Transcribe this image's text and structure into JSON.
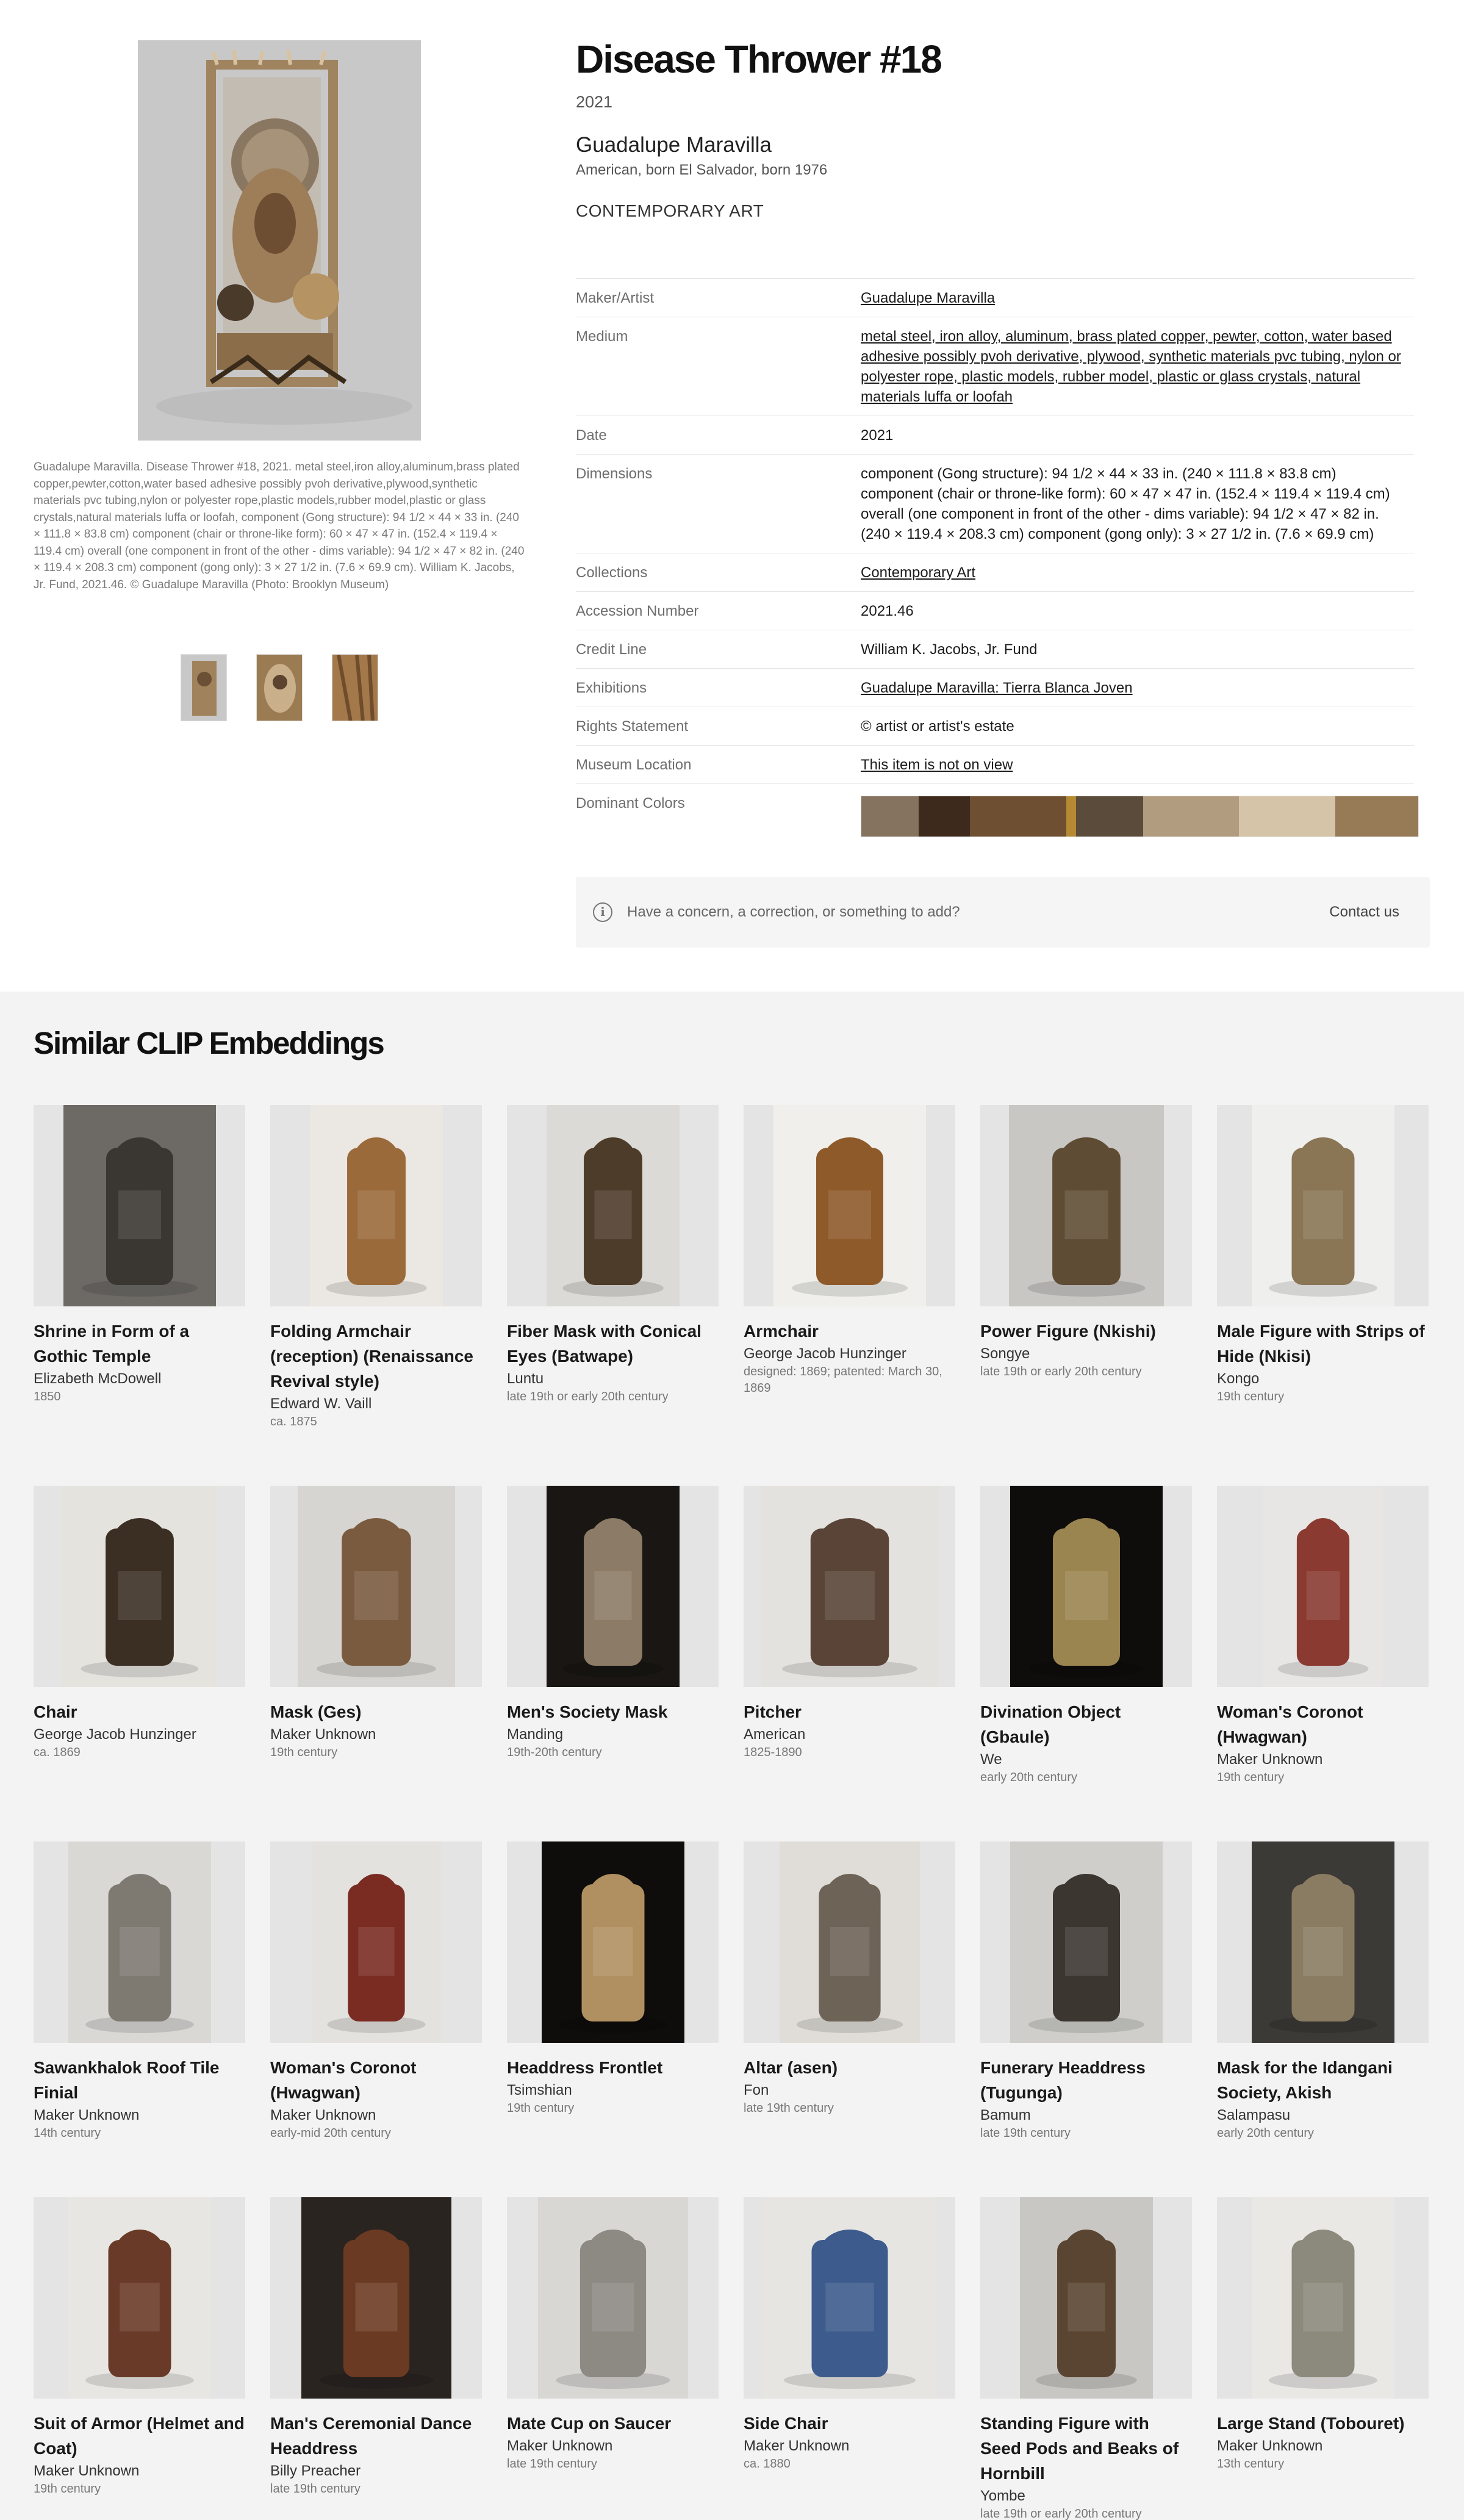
{
  "artwork": {
    "title": "Disease Thrower #18",
    "year": "2021",
    "artist": "Guadalupe Maravilla",
    "artist_bio": "American, born El Salvador, born 1976",
    "department": "CONTEMPORARY ART",
    "caption": "Guadalupe Maravilla. Disease Thrower #18, 2021. metal steel,iron alloy,aluminum,brass plated copper,pewter,cotton,water based adhesive possibly pvoh derivative,plywood,synthetic materials pvc tubing,nylon or polyester rope,plastic models,rubber model,plastic or glass crystals,natural materials luffa or loofah, component (Gong structure): 94 1/2 × 44 × 33 in. (240 × 111.8 × 83.8 cm) component (chair or throne-like form): 60 × 47 × 47 in. (152.4 × 119.4 × 119.4 cm) overall (one component in front of the other - dims variable): 94 1/2 × 47 × 82 in. (240 × 119.4 × 208.3 cm) component (gong only): 3 × 27 1/2 in. (7.6 × 69.9 cm). William K. Jacobs, Jr. Fund, 2021.46. © Guadalupe Maravilla (Photo: Brooklyn Museum)"
  },
  "details": [
    {
      "key": "Maker/Artist",
      "value": "Guadalupe Maravilla",
      "link": true
    },
    {
      "key": "Medium",
      "value": "metal steel, iron alloy, aluminum, brass plated copper, pewter, cotton, water based adhesive possibly pvoh derivative, plywood, synthetic materials pvc tubing, nylon or polyester rope, plastic models, rubber model, plastic or glass crystals, natural materials luffa or loofah",
      "link": true
    },
    {
      "key": "Date",
      "value": "2021",
      "link": false
    },
    {
      "key": "Dimensions",
      "value": "component (Gong structure): 94 1/2 × 44 × 33 in. (240 × 111.8 × 83.8 cm) component (chair or throne-like form): 60 × 47 × 47 in. (152.4 × 119.4 × 119.4 cm) overall (one component in front of the other - dims variable): 94 1/2 × 47 × 82 in. (240 × 119.4 × 208.3 cm) component (gong only): 3 × 27 1/2 in. (7.6 × 69.9 cm)",
      "link": false
    },
    {
      "key": "Collections",
      "value": "Contemporary Art",
      "link": true
    },
    {
      "key": "Accession Number",
      "value": "2021.46",
      "link": false
    },
    {
      "key": "Credit Line",
      "value": "William K. Jacobs, Jr. Fund",
      "link": false
    },
    {
      "key": "Exhibitions",
      "value": "Guadalupe Maravilla: Tierra Blanca Joven",
      "link": true
    },
    {
      "key": "Rights Statement",
      "value": "© artist or artist's estate",
      "link": false
    },
    {
      "key": "Museum Location",
      "value": "This item is not on view",
      "link": true
    }
  ],
  "dominant_colors": {
    "label": "Dominant Colors",
    "swatches": [
      {
        "color": "#857360",
        "share": 9
      },
      {
        "color": "#3d2a1d",
        "share": 8
      },
      {
        "color": "#6f4f31",
        "share": 15
      },
      {
        "color": "#b58a33",
        "share": 1.5
      },
      {
        "color": "#5b4b3a",
        "share": 10.5
      },
      {
        "color": "#b19c80",
        "share": 15
      },
      {
        "color": "#d6c4a8",
        "share": 15
      },
      {
        "color": "#977a56",
        "share": 13
      }
    ]
  },
  "concern": {
    "icon": "info-icon",
    "text": "Have a concern, a correction, or something to add?",
    "contact_label": "Contact us"
  },
  "similar": {
    "title": "Similar CLIP Embeddings",
    "items": [
      {
        "name": "Shrine in Form of a Gothic Temple",
        "maker": "Elizabeth McDowell",
        "date": "1850",
        "tone": "#3a3631",
        "bg": "#6d6a66",
        "imgw": 250
      },
      {
        "name": "Folding Armchair (reception) (Renaissance Revival style)",
        "maker": "Edward W. Vaill",
        "date": "ca. 1875",
        "tone": "#9a6a3a",
        "bg": "#ebe7e2",
        "imgw": 218
      },
      {
        "name": "Fiber Mask with Conical Eyes (Batwape)",
        "maker": "Luntu",
        "date": "late 19th or early 20th century",
        "tone": "#4e3c2b",
        "bg": "#dcdad6",
        "imgw": 218
      },
      {
        "name": "Armchair",
        "maker": "George Jacob Hunzinger",
        "date": "designed: 1869; patented: March 30, 1869",
        "tone": "#8e5a2a",
        "bg": "#f0efec",
        "imgw": 250
      },
      {
        "name": "Power Figure (Nkishi)",
        "maker": "Songye",
        "date": "late 19th or early 20th century",
        "tone": "#5f4c34",
        "bg": "#c8c7c4",
        "imgw": 254
      },
      {
        "name": "Male Figure with Strips of Hide (Nkisi)",
        "maker": "Kongo",
        "date": "19th century",
        "tone": "#8a7555",
        "bg": "#efefed",
        "imgw": 234
      },
      {
        "name": "Chair",
        "maker": "George Jacob Hunzinger",
        "date": "ca. 1869",
        "tone": "#3b2f24",
        "bg": "#e5e3de",
        "imgw": 254
      },
      {
        "name": "Mask (Ges)",
        "maker": "Maker Unknown",
        "date": "19th century",
        "tone": "#7a5b3f",
        "bg": "#d7d5d2",
        "imgw": 258
      },
      {
        "name": "Men's Society Mask",
        "maker": "Manding",
        "date": "19th-20th century",
        "tone": "#8c7b66",
        "bg": "#191613",
        "imgw": 218
      },
      {
        "name": "Pitcher",
        "maker": "American",
        "date": "1825-1890",
        "tone": "#5a4437",
        "bg": "#e4e2de",
        "imgw": 292
      },
      {
        "name": "Divination Object (Gbaule)",
        "maker": "We",
        "date": "early 20th century",
        "tone": "#9a8450",
        "bg": "#0f0d0b",
        "imgw": 250
      },
      {
        "name": "Woman's Coronot (Hwagwan)",
        "maker": "Maker Unknown",
        "date": "19th century",
        "tone": "#8a3a30",
        "bg": "#e8e6e4",
        "imgw": 196
      },
      {
        "name": "Sawankhalok Roof Tile Finial",
        "maker": "Maker Unknown",
        "date": "14th century",
        "tone": "#7e7a72",
        "bg": "#d9d8d5",
        "imgw": 234
      },
      {
        "name": "Woman's Coronot (Hwagwan)",
        "maker": "Maker Unknown",
        "date": "early-mid 20th century",
        "tone": "#7a2c22",
        "bg": "#e4e2df",
        "imgw": 212
      },
      {
        "name": "Headdress Frontlet",
        "maker": "Tsimshian",
        "date": "19th century",
        "tone": "#b09060",
        "bg": "#0f0d0b",
        "imgw": 234
      },
      {
        "name": "Altar (asen)",
        "maker": "Fon",
        "date": "late 19th century",
        "tone": "#6e6357",
        "bg": "#e0ddd8",
        "imgw": 230
      },
      {
        "name": "Funerary Headdress (Tugunga)",
        "maker": "Bamum",
        "date": "late 19th century",
        "tone": "#3c3630",
        "bg": "#cfceca",
        "imgw": 250
      },
      {
        "name": "Mask for the Idangani Society, Akish",
        "maker": "Salampasu",
        "date": "early 20th century",
        "tone": "#8a7c62",
        "bg": "#3c3a36",
        "imgw": 234
      },
      {
        "name": "Suit of Armor (Helmet and Coat)",
        "maker": "Maker Unknown",
        "date": "19th century",
        "tone": "#6a3a28",
        "bg": "#e8e6e2",
        "imgw": 234
      },
      {
        "name": "Man's Ceremonial Dance Headdress",
        "maker": "Billy Preacher",
        "date": "late 19th century",
        "tone": "#6b3a22",
        "bg": "#2a2420",
        "imgw": 246
      },
      {
        "name": "Mate Cup on Saucer",
        "maker": "Maker Unknown",
        "date": "late 19th century",
        "tone": "#8d8a84",
        "bg": "#d8d7d4",
        "imgw": 246
      },
      {
        "name": "Side Chair",
        "maker": "Maker Unknown",
        "date": "ca. 1880",
        "tone": "#3d5b8c",
        "bg": "#e6e5e2",
        "imgw": 284
      },
      {
        "name": "Standing Figure with Seed Pods and Beaks of Hornbill",
        "maker": "Yombe",
        "date": "late 19th or early 20th century",
        "tone": "#5a4532",
        "bg": "#c9c7c3",
        "imgw": 218
      },
      {
        "name": "Large Stand (Tobouret)",
        "maker": "Maker Unknown",
        "date": "13th century",
        "tone": "#8c8a7c",
        "bg": "#e9e8e5",
        "imgw": 234
      }
    ]
  }
}
